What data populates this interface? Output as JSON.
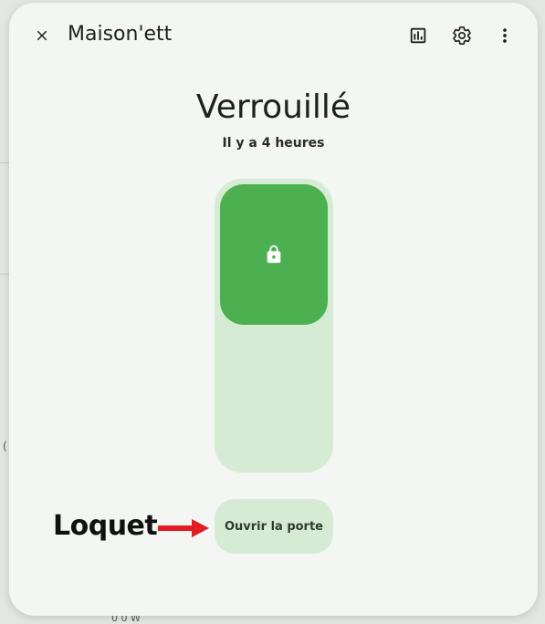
{
  "dialog": {
    "title": "Maison'ett",
    "state": "Verrouillé",
    "last_changed": "Il y a 4 heures"
  },
  "actions": {
    "open_door_label": "Ouvrir la porte"
  },
  "annotation": {
    "label": "Loquet"
  },
  "background": {
    "fragment_left": "(",
    "fragment_bottom": "0 0 W"
  },
  "colors": {
    "accent": "#4caf50",
    "accent_light": "#d6ebd4",
    "arrow": "#e31b23"
  },
  "icons": [
    "close-icon",
    "history-icon",
    "gear-icon",
    "more-vert-icon",
    "lock-icon",
    "arrow-icon"
  ]
}
